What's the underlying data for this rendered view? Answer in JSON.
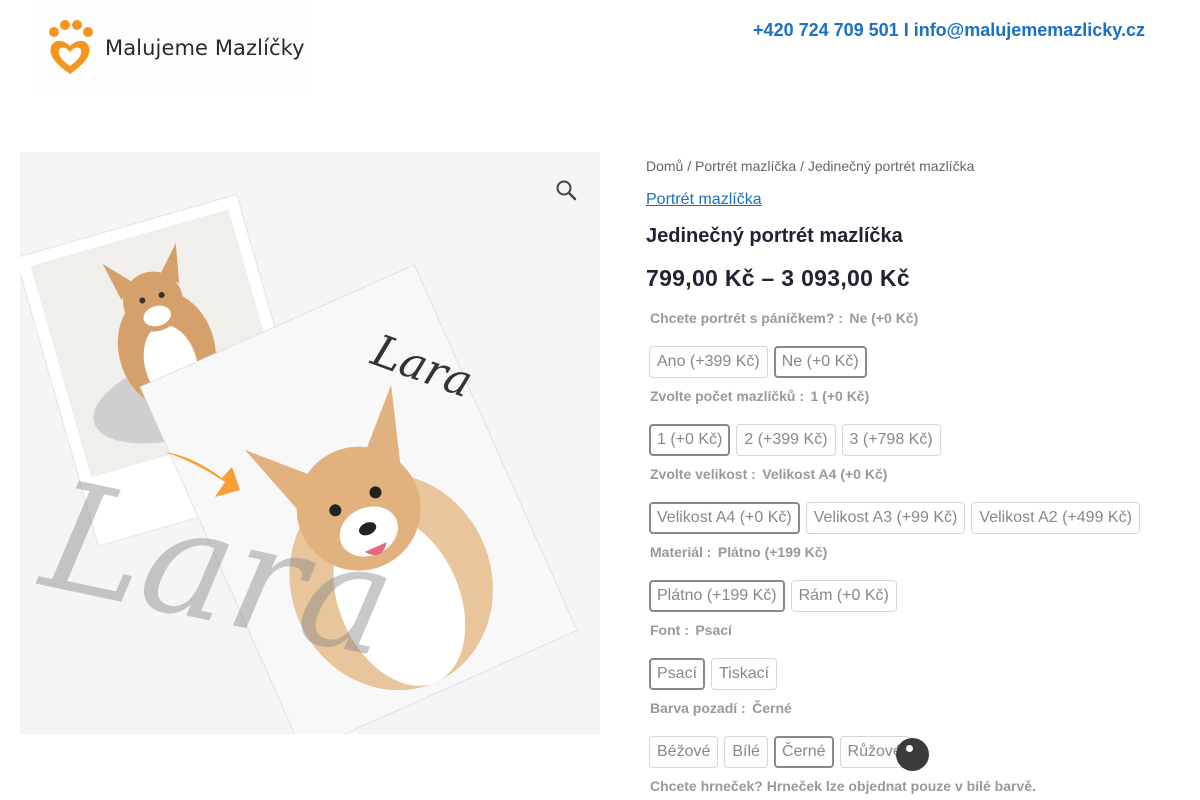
{
  "header": {
    "logo_text": "Malujeme Mazlíčky",
    "contact": "+420 724 709 501 I info@malujememazlicky.cz"
  },
  "breadcrumb": [
    {
      "label": "Domů"
    },
    {
      "label": "Portrét mazlíčka"
    },
    {
      "label": "Jedinečný portrét mazlíčka"
    }
  ],
  "category": "Portrét mazlíčka",
  "product": {
    "title": "Jedinečný portrét mazlíčka",
    "price": "799,00 Kč – 3 093,00 Kč"
  },
  "image_text": {
    "name_card": "Lara",
    "name_big": "Lara"
  },
  "attributes": [
    {
      "label": "Chcete portrét s páníčkem? :",
      "value": "Ne (+0 Kč)",
      "options": [
        "Ano (+399 Kč)",
        "Ne (+0 Kč)"
      ],
      "selected": 1
    },
    {
      "label": "Zvolte počet mazlíčků :",
      "value": "1 (+0 Kč)",
      "options": [
        "1 (+0 Kč)",
        "2 (+399 Kč)",
        "3 (+798 Kč)"
      ],
      "selected": 0
    },
    {
      "label": "Zvolte velikost :",
      "value": "Velikost A4 (+0 Kč)",
      "options": [
        "Velikost A4 (+0 Kč)",
        "Velikost A3 (+99 Kč)",
        "Velikost A2 (+499 Kč)"
      ],
      "selected": 0
    },
    {
      "label": "Materiál :",
      "value": "Plátno (+199 Kč)",
      "options": [
        "Plátno (+199 Kč)",
        "Rám (+0 Kč)"
      ],
      "selected": 0
    },
    {
      "label": "Font :",
      "value": "Psací",
      "options": [
        "Psací",
        "Tiskací"
      ],
      "selected": 0
    },
    {
      "label": "Barva pozadí :",
      "value": "Černé",
      "options": [
        "Béžové",
        "Bílé",
        "Černé",
        "Růžové"
      ],
      "selected": 2
    }
  ],
  "mug_label": "Chcete hrneček? Hrneček lze objednat pouze v bílé barvě.",
  "colors": {
    "link": "#1a6fc9",
    "logo_orange": "#f7941d"
  }
}
